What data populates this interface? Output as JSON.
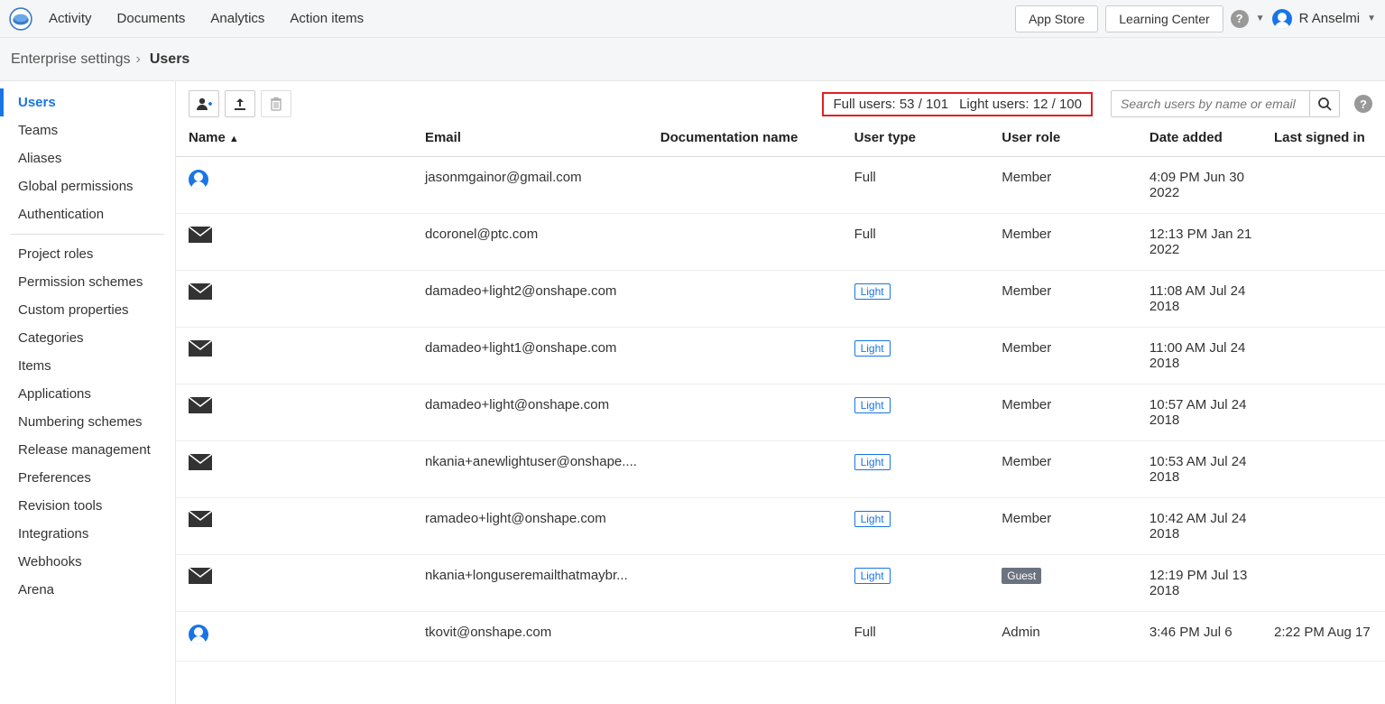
{
  "nav": {
    "links": [
      "Activity",
      "Documents",
      "Analytics",
      "Action items"
    ],
    "app_store": "App Store",
    "learning_center": "Learning Center",
    "user_name": "R Anselmi"
  },
  "breadcrumb": {
    "root": "Enterprise settings",
    "current": "Users"
  },
  "sidebar": {
    "group1": [
      "Users",
      "Teams",
      "Aliases",
      "Global permissions",
      "Authentication"
    ],
    "group2": [
      "Project roles",
      "Permission schemes",
      "Custom properties",
      "Categories",
      "Items",
      "Applications",
      "Numbering schemes",
      "Release management",
      "Preferences",
      "Revision tools",
      "Integrations",
      "Webhooks",
      "Arena"
    ],
    "active": "Users"
  },
  "counts": {
    "full_label": "Full users: 53 / 101",
    "light_label": "Light users: 12 / 100"
  },
  "search": {
    "placeholder": "Search users by name or email"
  },
  "columns": {
    "name": "Name",
    "email": "Email",
    "doc": "Documentation name",
    "type": "User type",
    "role": "User role",
    "date": "Date added",
    "signed": "Last signed in"
  },
  "labels": {
    "full": "Full",
    "light": "Light",
    "member": "Member",
    "admin": "Admin",
    "guest": "Guest"
  },
  "rows": [
    {
      "icon": "avatar",
      "email": "jasonmgainor@gmail.com",
      "type": "full",
      "role": "member",
      "date": "4:09 PM Jun 30 2022",
      "signed": ""
    },
    {
      "icon": "mail",
      "email": "dcoronel@ptc.com",
      "type": "full",
      "role": "member",
      "date": "12:13 PM Jan 21 2022",
      "signed": ""
    },
    {
      "icon": "mail",
      "email": "damadeo+light2@onshape.com",
      "type": "light",
      "role": "member",
      "date": "11:08 AM Jul 24 2018",
      "signed": ""
    },
    {
      "icon": "mail",
      "email": "damadeo+light1@onshape.com",
      "type": "light",
      "role": "member",
      "date": "11:00 AM Jul 24 2018",
      "signed": ""
    },
    {
      "icon": "mail",
      "email": "damadeo+light@onshape.com",
      "type": "light",
      "role": "member",
      "date": "10:57 AM Jul 24 2018",
      "signed": ""
    },
    {
      "icon": "mail",
      "email": "nkania+anewlightuser@onshape....",
      "type": "light",
      "role": "member",
      "date": "10:53 AM Jul 24 2018",
      "signed": ""
    },
    {
      "icon": "mail",
      "email": "ramadeo+light@onshape.com",
      "type": "light",
      "role": "member",
      "date": "10:42 AM Jul 24 2018",
      "signed": ""
    },
    {
      "icon": "mail",
      "email": "nkania+longuseremailthatmaybr...",
      "type": "light",
      "role": "guest",
      "date": "12:19 PM Jul 13 2018",
      "signed": ""
    },
    {
      "icon": "avatar",
      "email": "tkovit@onshape.com",
      "type": "full",
      "role": "admin",
      "date": "3:46 PM Jul 6",
      "signed": "2:22 PM Aug 17"
    }
  ]
}
